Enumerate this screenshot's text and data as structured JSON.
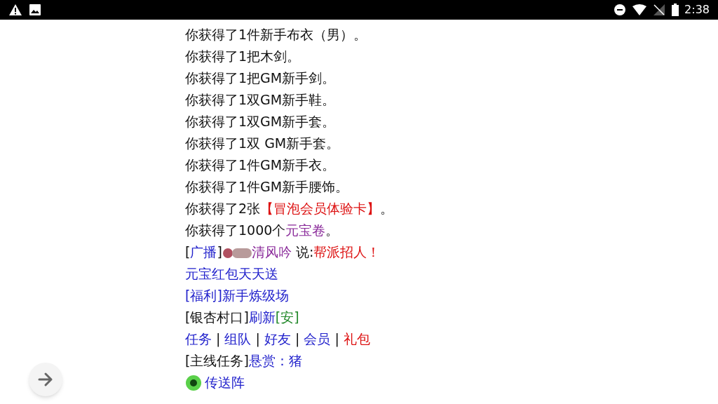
{
  "status_bar": {
    "time": "2:38"
  },
  "lines": [
    [
      {
        "kind": "text",
        "text": "你获得了1件新手布衣（男）。"
      }
    ],
    [
      {
        "kind": "text",
        "text": "你获得了1把木剑。"
      }
    ],
    [
      {
        "kind": "text",
        "text": "你获得了1把GM新手剑。"
      }
    ],
    [
      {
        "kind": "text",
        "text": "你获得了1双GM新手鞋。"
      }
    ],
    [
      {
        "kind": "text",
        "text": "你获得了1双GM新手套。"
      }
    ],
    [
      {
        "kind": "text",
        "text": "你获得了1双 GM新手套。"
      }
    ],
    [
      {
        "kind": "text",
        "text": "你获得了1件GM新手衣。"
      }
    ],
    [
      {
        "kind": "text",
        "text": "你获得了1件GM新手腰饰。"
      }
    ],
    [
      {
        "kind": "text",
        "text": "你获得了2张"
      },
      {
        "kind": "alert",
        "text": "【冒泡会员体验卡】"
      },
      {
        "kind": "text",
        "text": "。"
      }
    ],
    [
      {
        "kind": "text",
        "text": "你获得了1000个"
      },
      {
        "kind": "name",
        "text": "元宝卷"
      },
      {
        "kind": "text",
        "text": "。"
      }
    ],
    [
      {
        "kind": "text",
        "text": "["
      },
      {
        "kind": "link",
        "text": "广播"
      },
      {
        "kind": "text",
        "text": "]"
      },
      {
        "kind": "badge"
      },
      {
        "kind": "name",
        "text": "清风吟"
      },
      {
        "kind": "text",
        "text": " 说:"
      },
      {
        "kind": "alert",
        "text": "帮派招人！"
      }
    ],
    [
      {
        "kind": "link",
        "text": "元宝红包天天送"
      }
    ],
    [
      {
        "kind": "link",
        "text": "[福利]新手炼级场"
      }
    ],
    [
      {
        "kind": "text",
        "text": "[银杏村口]"
      },
      {
        "kind": "link",
        "text": "刷新"
      },
      {
        "kind": "safe",
        "text": "[安]"
      }
    ],
    [
      {
        "kind": "link",
        "text": "任务"
      },
      {
        "kind": "text",
        "text": " | "
      },
      {
        "kind": "link",
        "text": "组队"
      },
      {
        "kind": "text",
        "text": " | "
      },
      {
        "kind": "link",
        "text": "好友"
      },
      {
        "kind": "text",
        "text": " | "
      },
      {
        "kind": "link",
        "text": "会员"
      },
      {
        "kind": "text",
        "text": " | "
      },
      {
        "kind": "alertlink",
        "text": "礼包"
      }
    ],
    [
      {
        "kind": "text",
        "text": "[主线任务]"
      },
      {
        "kind": "link",
        "text": "悬赏：猪"
      }
    ],
    [
      {
        "kind": "portal"
      },
      {
        "kind": "link",
        "text": "传送阵"
      }
    ]
  ]
}
